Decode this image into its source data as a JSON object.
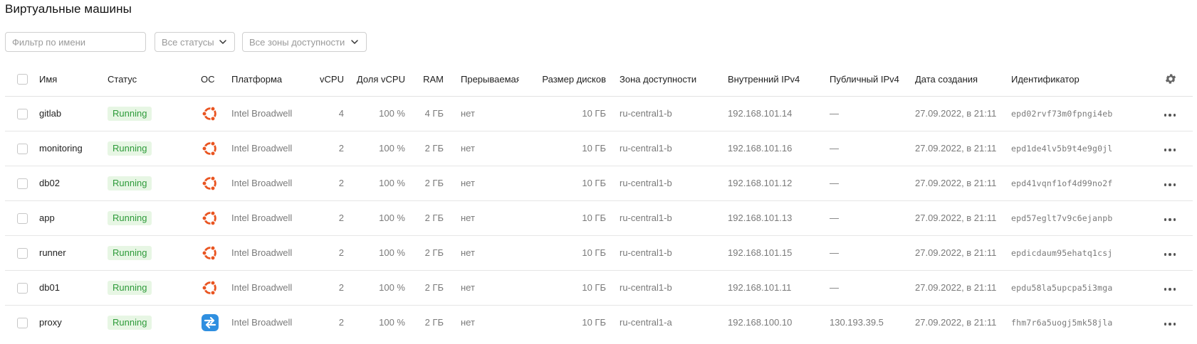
{
  "page": {
    "title": "Виртуальные машины"
  },
  "filters": {
    "name_placeholder": "Фильтр по имени",
    "name_value": "",
    "status_label": "Все статусы",
    "zone_label": "Все зоны доступности"
  },
  "table": {
    "columns": {
      "name": "Имя",
      "status": "Статус",
      "os": "ОС",
      "platform": "Платформа",
      "vcpu": "vCPU",
      "vcpu_share": "Доля vCPU",
      "ram": "RAM",
      "preemptible": "Прерываемая",
      "disk_size": "Размер дисков",
      "zone": "Зона доступности",
      "internal_ipv4": "Внутренний IPv4",
      "public_ipv4": "Публичный IPv4",
      "created": "Дата создания",
      "id": "Идентификатор"
    },
    "rows": [
      {
        "name": "gitlab",
        "status": "Running",
        "os_icon": "ubuntu-icon",
        "platform": "Intel Broadwell",
        "vcpu": "4",
        "vcpu_share": "100 %",
        "ram": "4 ГБ",
        "preemptible": "нет",
        "disk_size": "10 ГБ",
        "zone": "ru-central1-b",
        "internal_ipv4": "192.168.101.14",
        "public_ipv4": "—",
        "created": "27.09.2022, в 21:11",
        "id": "epd02rvf73m0fpngi4eb"
      },
      {
        "name": "monitoring",
        "status": "Running",
        "os_icon": "ubuntu-icon",
        "platform": "Intel Broadwell",
        "vcpu": "2",
        "vcpu_share": "100 %",
        "ram": "2 ГБ",
        "preemptible": "нет",
        "disk_size": "10 ГБ",
        "zone": "ru-central1-b",
        "internal_ipv4": "192.168.101.16",
        "public_ipv4": "—",
        "created": "27.09.2022, в 21:11",
        "id": "epd1de4lv5b9t4e9g0jl"
      },
      {
        "name": "db02",
        "status": "Running",
        "os_icon": "ubuntu-icon",
        "platform": "Intel Broadwell",
        "vcpu": "2",
        "vcpu_share": "100 %",
        "ram": "2 ГБ",
        "preemptible": "нет",
        "disk_size": "10 ГБ",
        "zone": "ru-central1-b",
        "internal_ipv4": "192.168.101.12",
        "public_ipv4": "—",
        "created": "27.09.2022, в 21:11",
        "id": "epd41vqnf1of4d99no2f"
      },
      {
        "name": "app",
        "status": "Running",
        "os_icon": "ubuntu-icon",
        "platform": "Intel Broadwell",
        "vcpu": "2",
        "vcpu_share": "100 %",
        "ram": "2 ГБ",
        "preemptible": "нет",
        "disk_size": "10 ГБ",
        "zone": "ru-central1-b",
        "internal_ipv4": "192.168.101.13",
        "public_ipv4": "—",
        "created": "27.09.2022, в 21:11",
        "id": "epd57eglt7v9c6ejanpb"
      },
      {
        "name": "runner",
        "status": "Running",
        "os_icon": "ubuntu-icon",
        "platform": "Intel Broadwell",
        "vcpu": "2",
        "vcpu_share": "100 %",
        "ram": "2 ГБ",
        "preemptible": "нет",
        "disk_size": "10 ГБ",
        "zone": "ru-central1-b",
        "internal_ipv4": "192.168.101.15",
        "public_ipv4": "—",
        "created": "27.09.2022, в 21:11",
        "id": "epdicdaum95ehatq1csj"
      },
      {
        "name": "db01",
        "status": "Running",
        "os_icon": "ubuntu-icon",
        "platform": "Intel Broadwell",
        "vcpu": "2",
        "vcpu_share": "100 %",
        "ram": "2 ГБ",
        "preemptible": "нет",
        "disk_size": "10 ГБ",
        "zone": "ru-central1-b",
        "internal_ipv4": "192.168.101.11",
        "public_ipv4": "—",
        "created": "27.09.2022, в 21:11",
        "id": "epdu58la5upcpa5i3mga"
      },
      {
        "name": "proxy",
        "status": "Running",
        "os_icon": "nat-instance-icon",
        "platform": "Intel Broadwell",
        "vcpu": "2",
        "vcpu_share": "100 %",
        "ram": "2 ГБ",
        "preemptible": "нет",
        "disk_size": "10 ГБ",
        "zone": "ru-central1-a",
        "internal_ipv4": "192.168.100.10",
        "public_ipv4": "130.193.39.5",
        "created": "27.09.2022, в 21:11",
        "id": "fhm7r6a5uogj5mk58jla"
      }
    ]
  },
  "colors": {
    "status_running_bg": "#e7f6e4",
    "status_running_text": "#2e9b3a",
    "ubuntu_orange": "#e95420",
    "nat_blue": "#2f8fe0"
  }
}
